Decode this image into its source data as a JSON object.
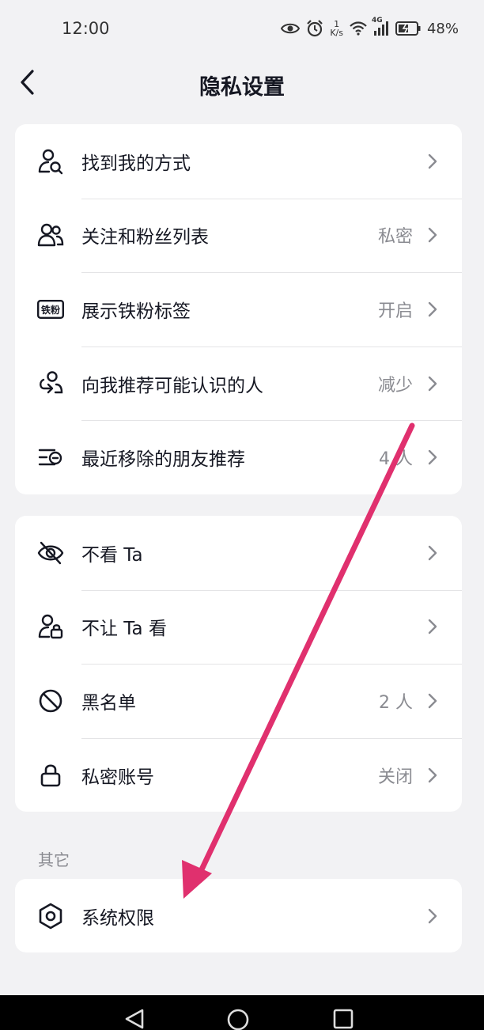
{
  "status_bar": {
    "time": "12:00",
    "speed_value": "1",
    "speed_unit": "K/s",
    "network": "4G",
    "battery": "48%"
  },
  "header": {
    "title": "隐私设置"
  },
  "group1": [
    {
      "label": "找到我的方式",
      "value": ""
    },
    {
      "label": "关注和粉丝列表",
      "value": "私密"
    },
    {
      "label": "展示铁粉标签",
      "value": "开启"
    },
    {
      "label": "向我推荐可能认识的人",
      "value": "减少"
    },
    {
      "label": "最近移除的朋友推荐",
      "value": "4 人"
    }
  ],
  "group2": [
    {
      "label": "不看 Ta",
      "value": ""
    },
    {
      "label": "不让 Ta 看",
      "value": ""
    },
    {
      "label": "黑名单",
      "value": "2 人"
    },
    {
      "label": "私密账号",
      "value": "关闭"
    }
  ],
  "section_other": {
    "label": "其它",
    "items": [
      {
        "label": "系统权限",
        "value": ""
      }
    ]
  },
  "fan_badge_text": "铁粉",
  "annotation": {
    "color": "#e0306e"
  }
}
